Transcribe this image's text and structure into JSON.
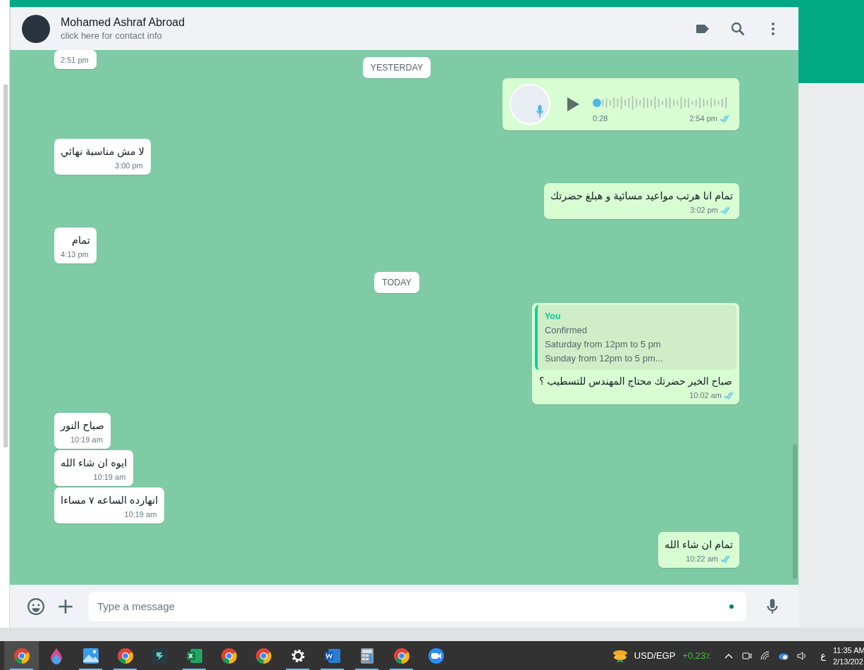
{
  "header": {
    "name": "Mohamed Ashraf Abroad",
    "subtitle": "click here for contact info"
  },
  "messages": [
    {
      "kind": "text",
      "outgoing": false,
      "time": "2:51 pm"
    },
    {
      "kind": "date",
      "label": "YESTERDAY"
    },
    {
      "kind": "voice",
      "outgoing": true,
      "duration": "0:28",
      "time": "2:54 pm",
      "read": true,
      "level": 0.0
    },
    {
      "kind": "text",
      "outgoing": false,
      "text": "لا مش مناسبة نهائي",
      "time": "3:00 pm"
    },
    {
      "kind": "text",
      "outgoing": true,
      "text": "تمام انا هرتب مواعيد مسائية و هبلغ حضرتك",
      "time": "3:02 pm",
      "read": true
    },
    {
      "kind": "text",
      "outgoing": false,
      "text": "تمام",
      "time": "4:13 pm"
    },
    {
      "kind": "date",
      "label": "TODAY"
    },
    {
      "kind": "reply",
      "outgoing": true,
      "quote_author": "You",
      "quote_lines": [
        "Confirmed",
        "Saturday from 12pm to 5 pm",
        "Sunday from 12pm to 5 pm..."
      ],
      "text": "صباح الخير حضرتك محتاج المهندس للتسطيب ؟",
      "time": "10:02 am",
      "read": true
    },
    {
      "kind": "text",
      "outgoing": false,
      "text": "صباح النور",
      "time": "10:19 am"
    },
    {
      "kind": "text",
      "outgoing": false,
      "text": "ايوه ان شاء الله",
      "time": "10:19 am"
    },
    {
      "kind": "text",
      "outgoing": false,
      "text": "انهارده الساعه ٧ مساءا",
      "time": "10:19 am"
    },
    {
      "kind": "text",
      "outgoing": true,
      "text": "تمام ان شاء الله",
      "time": "10:22 am",
      "read": true
    }
  ],
  "composer": {
    "placeholder": "Type a message"
  },
  "taskbar": {
    "apps": [
      {
        "kind": "chrome",
        "selected": true,
        "running": true
      },
      {
        "kind": "drop",
        "selected": false,
        "running": false
      },
      {
        "kind": "photos",
        "selected": false,
        "running": true
      },
      {
        "kind": "chrome",
        "selected": false,
        "running": true
      },
      {
        "kind": "editor",
        "selected": false,
        "running": false
      },
      {
        "kind": "excel",
        "selected": false,
        "running": true
      },
      {
        "kind": "chrome",
        "selected": false,
        "running": false
      },
      {
        "kind": "chrome",
        "selected": false,
        "running": false
      },
      {
        "kind": "settings",
        "selected": false,
        "running": true
      },
      {
        "kind": "word",
        "selected": false,
        "running": true
      },
      {
        "kind": "calculator",
        "selected": false,
        "running": true
      },
      {
        "kind": "chrome",
        "selected": false,
        "running": true
      },
      {
        "kind": "zoom",
        "selected": false,
        "running": false
      }
    ],
    "ticker": {
      "pair": "USD/EGP",
      "change": "+0,23٪"
    },
    "language": "ع",
    "time": "11:35 AM",
    "date": "2/13/202"
  }
}
